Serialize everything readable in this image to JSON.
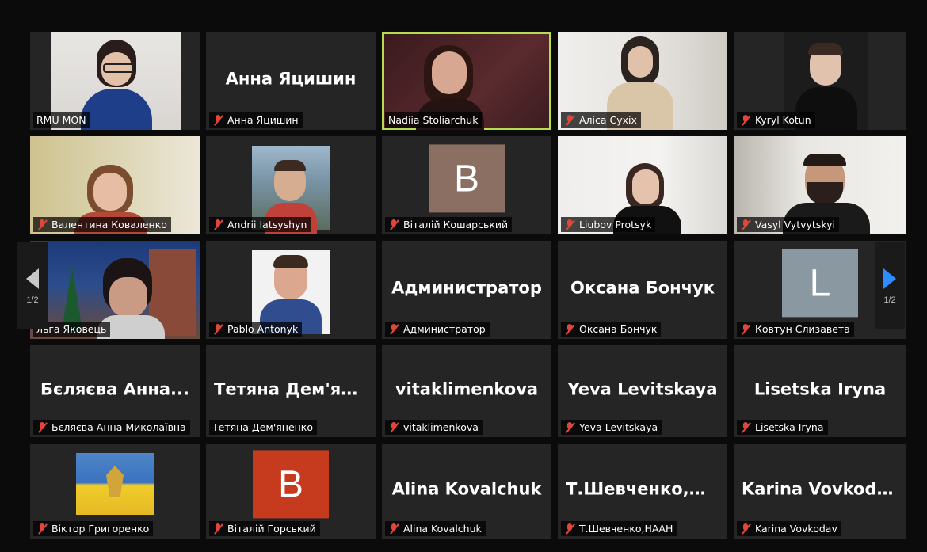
{
  "pager": {
    "prev": "1/2",
    "next": "1/2"
  },
  "tiles": [
    {
      "display": "",
      "label": "RMU MON",
      "muted": false
    },
    {
      "display": "Анна Яцишин",
      "label": "Анна Яцишин",
      "muted": true
    },
    {
      "display": "",
      "label": "Nadiia Stoliarchuk",
      "muted": false,
      "active": true
    },
    {
      "display": "",
      "label": "Аліса Сухіх",
      "muted": true
    },
    {
      "display": "",
      "label": "Kyryl Kotun",
      "muted": true
    },
    {
      "display": "",
      "label": "Валентина Коваленко",
      "muted": true
    },
    {
      "display": "",
      "label": "Andrii Iatsyshyn",
      "muted": true
    },
    {
      "display": "",
      "label": "Віталій Кошарський",
      "muted": true,
      "avatar": "B"
    },
    {
      "display": "",
      "label": "Liubov Protsyk",
      "muted": true
    },
    {
      "display": "",
      "label": "Vasyl Vytvytskyi",
      "muted": true
    },
    {
      "display": "",
      "label": "льга Яковець",
      "muted": false
    },
    {
      "display": "",
      "label": "Pablo Antonyk",
      "muted": true
    },
    {
      "display": "Администратор",
      "label": "Администратор",
      "muted": true
    },
    {
      "display": "Оксана Бончук",
      "label": "Оксана Бончук",
      "muted": true
    },
    {
      "display": "",
      "label": "Ковтун Єлизавета",
      "muted": true,
      "avatar": "L"
    },
    {
      "display": "Бєляєва Анна...",
      "label": "Бєляєва Анна Миколаївна",
      "muted": true
    },
    {
      "display": "Тетяна Дем'ян...",
      "label": "Тетяна Дем'яненко",
      "muted": false
    },
    {
      "display": "vitaklimenkova",
      "label": "vitaklimenkova",
      "muted": true
    },
    {
      "display": "Yeva Levitskaya",
      "label": "Yeva Levitskaya",
      "muted": true
    },
    {
      "display": "Lisetska Iryna",
      "label": "Lisetska Iryna",
      "muted": true
    },
    {
      "display": "",
      "label": "Віктор Григоренко",
      "muted": true
    },
    {
      "display": "",
      "label": "Віталій Горський",
      "muted": true,
      "avatar": "B"
    },
    {
      "display": "Alina Kovalchuk",
      "label": "Alina Kovalchuk",
      "muted": true
    },
    {
      "display": "Т.Шевченко,Н...",
      "label": "Т.Шевченко,НААН",
      "muted": true
    },
    {
      "display": "Karina Vovkodav",
      "label": "Karina Vovkodav",
      "muted": true
    }
  ],
  "colors": {
    "active_border": "#b7dc4e",
    "muted_icon": "#e0473c",
    "nav_arrow_left": "#c8c8c8",
    "nav_arrow_right": "#2d8cff"
  }
}
